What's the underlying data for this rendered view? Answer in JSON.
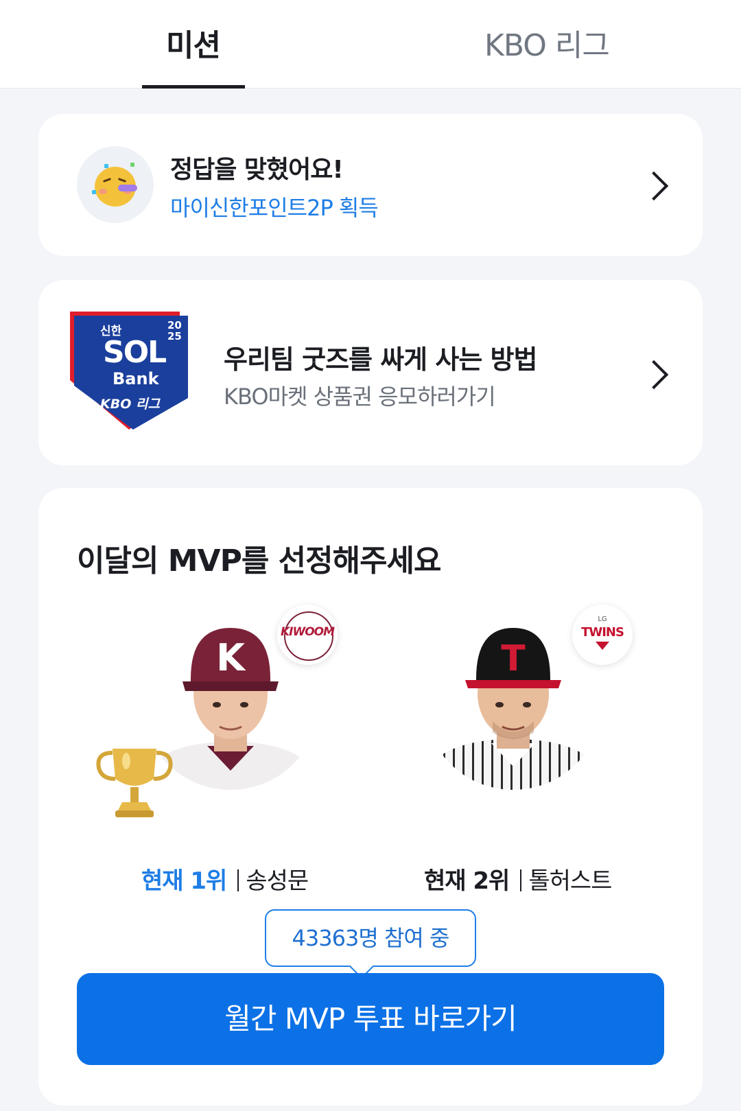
{
  "tabs": [
    {
      "label": "미션",
      "active": true
    },
    {
      "label": "KBO 리그",
      "active": false
    }
  ],
  "mission_card": {
    "icon": "party-face-emoji",
    "title": "정답을 맞혔어요!",
    "subtitle": "마이신한포인트2P 획득",
    "subtitle_color": "#1e7de6"
  },
  "goods_card": {
    "logo": {
      "line1": "신한",
      "year_top": "20",
      "year_bottom": "25",
      "sol": "SOL",
      "bank": "Bank",
      "league": "KBO 리그"
    },
    "title": "우리팀 굿즈를 싸게 사는 방법",
    "subtitle": "KBO마켓 상품권 응모하러가기"
  },
  "mvp": {
    "title": "이달의 MVP를 선정해주세요",
    "players": [
      {
        "rank_label": "현재 1위",
        "name": "송성문",
        "team": "KIWOOM",
        "cap_letter": "K",
        "has_trophy": true
      },
      {
        "rank_label": "현재 2위",
        "name": "톨허스트",
        "team": "TWINS",
        "team_prefix": "LG",
        "cap_letter": "T",
        "has_trophy": false
      }
    ],
    "participants": "43363명 참여 중",
    "cta_label": "월간 MVP 투표 바로가기",
    "accent_color": "#0c71e6"
  }
}
